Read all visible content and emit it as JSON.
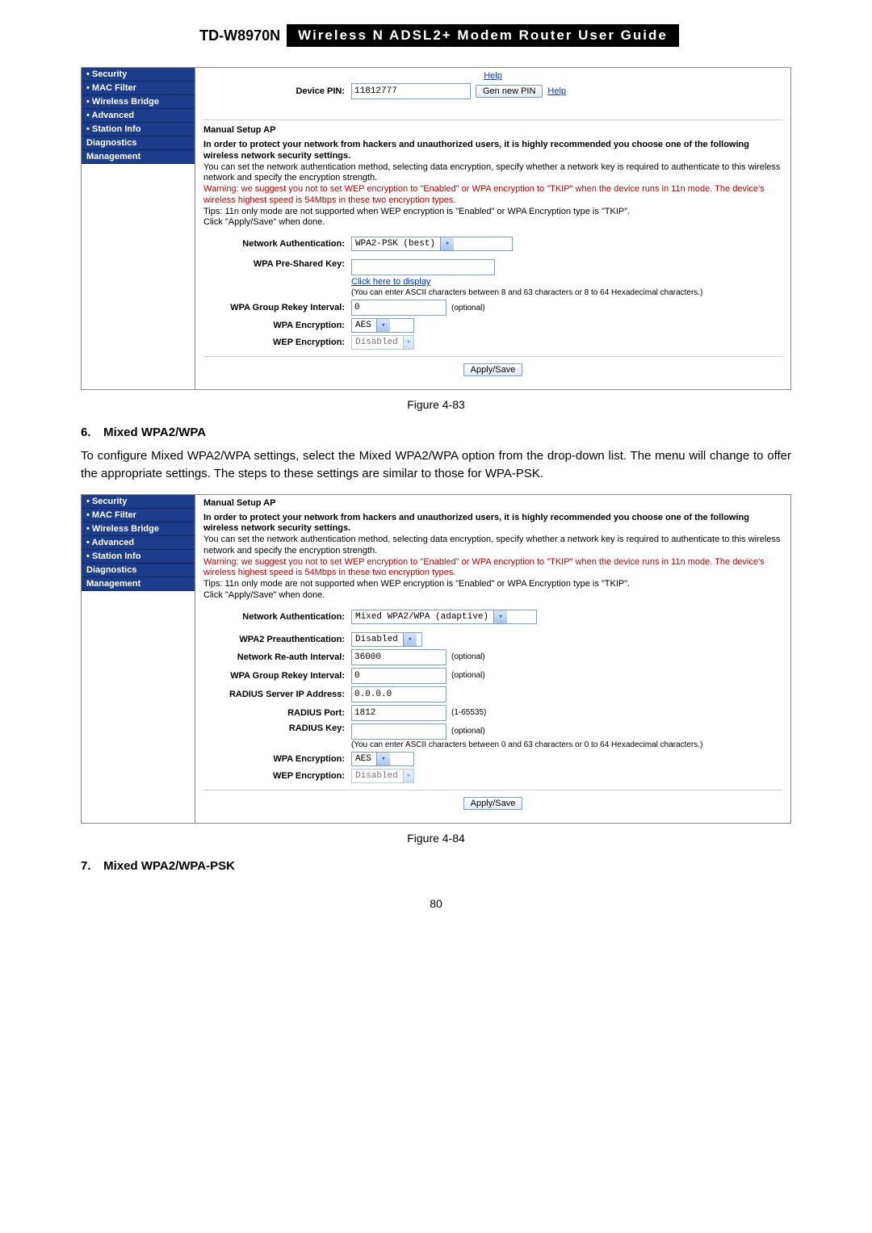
{
  "header": {
    "model": "TD-W8970N",
    "guide": "Wireless  N  ADSL2+  Modem  Router  User  Guide"
  },
  "fig1": {
    "sidebar": {
      "items": [
        {
          "label": "Security",
          "dot": true
        },
        {
          "label": "MAC Filter",
          "dot": true
        },
        {
          "label": "Wireless Bridge",
          "dot": true
        },
        {
          "label": "Advanced",
          "dot": true
        },
        {
          "label": "Station Info",
          "dot": true
        },
        {
          "label": "Diagnostics",
          "dot": false
        },
        {
          "label": "Management",
          "dot": false
        }
      ]
    },
    "topHelp": "Help",
    "devicePin": {
      "label": "Device PIN:",
      "value": "11812777",
      "genBtn": "Gen new PIN",
      "help": "Help"
    },
    "sectionTitle": "Manual Setup AP",
    "infoBold": "In order to protect your network from hackers and unauthorized users, it is highly recommended you choose one of the following wireless network security settings.",
    "info1": "You can set the network authentication method, selecting data encryption, specify whether a network key is required to authenticate to this wireless network and specify the encryption strength.",
    "infoRed": "Warning: we suggest you not to set WEP encryption to \"Enabled\" or WPA encryption to \"TKIP\" when the device runs in 11n mode. The device's wireless highest speed is 54Mbps in these two encryption types.",
    "info2": "Tips: 11n only mode are not supported when WEP encryption is \"Enabled\" or WPA Encryption type is \"TKIP\".",
    "info3": "Click \"Apply/Save\" when done.",
    "netAuth": {
      "label": "Network Authentication:",
      "value": "WPA2-PSK (best)"
    },
    "psk": {
      "label": "WPA Pre-Shared Key:",
      "value": "",
      "link": "Click here to display",
      "hint": "(You can enter ASCII characters between 8 and 63 characters or 8 to 64 Hexadecimal characters.)"
    },
    "rekey": {
      "label": "WPA Group Rekey Interval:",
      "value": "0",
      "note": "(optional)"
    },
    "wpaEnc": {
      "label": "WPA Encryption:",
      "value": "AES"
    },
    "wepEnc": {
      "label": "WEP Encryption:",
      "value": "Disabled"
    },
    "apply": "Apply/Save",
    "caption": "Figure 4-83"
  },
  "section6": {
    "num": "6.",
    "title": "Mixed WPA2/WPA",
    "body": "To configure Mixed WPA2/WPA settings, select the Mixed WPA2/WPA option from the drop-down list. The menu will change to offer the appropriate settings. The steps to these settings are similar to those for WPA-PSK."
  },
  "fig2": {
    "sidebar": {
      "items": [
        {
          "label": "Security",
          "dot": true
        },
        {
          "label": "MAC Filter",
          "dot": true
        },
        {
          "label": "Wireless Bridge",
          "dot": true
        },
        {
          "label": "Advanced",
          "dot": true
        },
        {
          "label": "Station Info",
          "dot": true
        },
        {
          "label": "Diagnostics",
          "dot": false
        },
        {
          "label": "Management",
          "dot": false
        }
      ]
    },
    "sectionTitle": "Manual Setup AP",
    "infoBold": "In order to protect your network from hackers and unauthorized users, it is highly recommended you choose one of the following wireless network security settings.",
    "info1": "You can set the network authentication method, selecting data encryption, specify whether a network key is required to authenticate to this wireless network and specify the encryption strength.",
    "infoRed": "Warning: we suggest you not to set WEP encryption to \"Enabled\" or WPA encryption to \"TKIP\" when the device runs in 11n mode. The device's wireless highest speed is 54Mbps in these two encryption types.",
    "info2": "Tips: 11n only mode are not supported when WEP encryption is \"Enabled\" or WPA Encryption type is \"TKIP\".",
    "info3": "Click \"Apply/Save\" when done.",
    "netAuth": {
      "label": "Network Authentication:",
      "value": "Mixed WPA2/WPA (adaptive)"
    },
    "wpa2preauth": {
      "label": "WPA2 Preauthentication:",
      "value": "Disabled"
    },
    "reauth": {
      "label": "Network Re-auth Interval:",
      "value": "36000",
      "note": "(optional)"
    },
    "rekey": {
      "label": "WPA Group Rekey Interval:",
      "value": "0",
      "note": "(optional)"
    },
    "radiusIp": {
      "label": "RADIUS Server IP Address:",
      "value": "0.0.0.0"
    },
    "radiusPort": {
      "label": "RADIUS Port:",
      "value": "1812",
      "note": "(1-65535)"
    },
    "radiusKey": {
      "label": "RADIUS Key:",
      "value": "",
      "note": "(optional)",
      "hint": "(You can enter ASCII characters between 0 and 63 characters or 0 to 64 Hexadecimal characters.)"
    },
    "wpaEnc": {
      "label": "WPA Encryption:",
      "value": "AES"
    },
    "wepEnc": {
      "label": "WEP Encryption:",
      "value": "Disabled"
    },
    "apply": "Apply/Save",
    "caption": "Figure 4-84"
  },
  "section7": {
    "num": "7.",
    "title": "Mixed WPA2/WPA-PSK"
  },
  "pageNumber": "80"
}
